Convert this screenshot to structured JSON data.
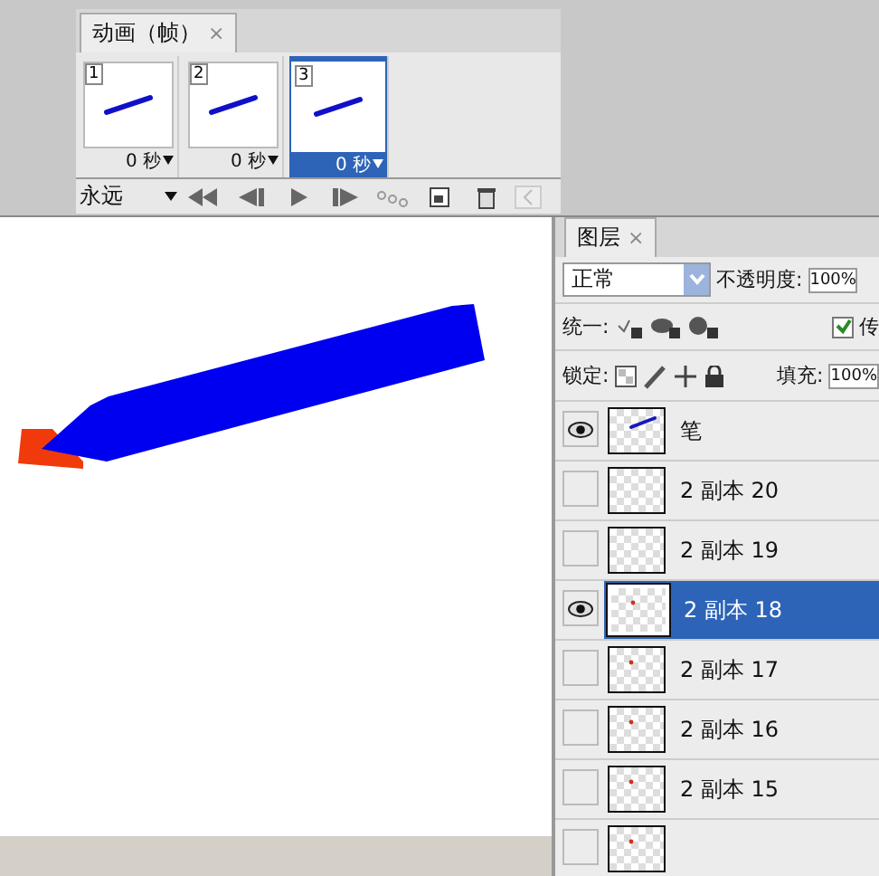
{
  "animation_panel": {
    "tab": {
      "label": "动画（帧）",
      "close": "×"
    },
    "frames": [
      {
        "number": "1",
        "delay": "0 秒",
        "selected": false
      },
      {
        "number": "2",
        "delay": "0 秒",
        "selected": false
      },
      {
        "number": "3",
        "delay": "0 秒",
        "selected": true
      }
    ],
    "loop": "永远"
  },
  "layers_panel": {
    "tab": {
      "label": "图层",
      "close": "×"
    },
    "blend_mode": "正常",
    "opacity_label": "不透明度:",
    "opacity": "100%",
    "unify_label": "统一:",
    "propagate": {
      "label": "传",
      "checked": true
    },
    "lock_label": "锁定:",
    "fill_label": "填充:",
    "fill": "100%",
    "layers": [
      {
        "name": "笔",
        "visible": true,
        "selected": false,
        "kind": "pen"
      },
      {
        "name": "2 副本 20",
        "visible": false,
        "selected": false,
        "kind": "empty"
      },
      {
        "name": "2 副本 19",
        "visible": false,
        "selected": false,
        "kind": "empty"
      },
      {
        "name": "2 副本 18",
        "visible": true,
        "selected": true,
        "kind": "dot"
      },
      {
        "name": "2 副本 17",
        "visible": false,
        "selected": false,
        "kind": "dot"
      },
      {
        "name": "2 副本 16",
        "visible": false,
        "selected": false,
        "kind": "dot"
      },
      {
        "name": "2 副本 15",
        "visible": false,
        "selected": false,
        "kind": "dot"
      },
      {
        "visible": false,
        "selected": false,
        "kind": "dot"
      }
    ]
  }
}
